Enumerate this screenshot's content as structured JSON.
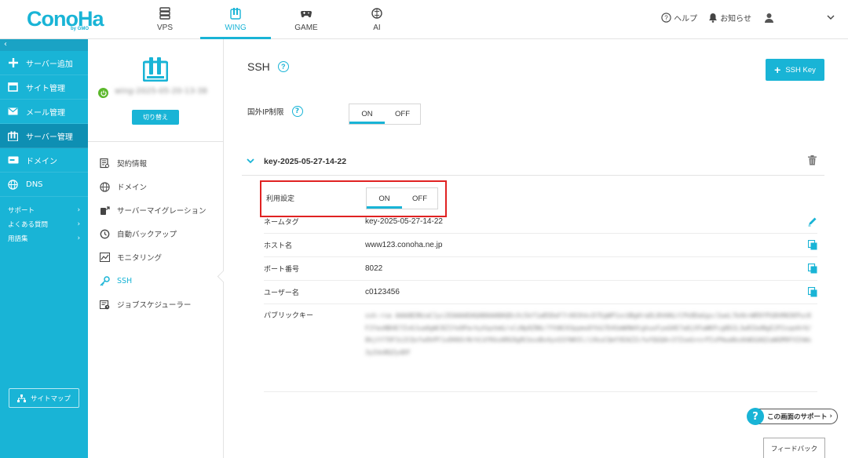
{
  "logo": {
    "text": "ConoHa",
    "sub": "by GMO"
  },
  "topnav": [
    {
      "label": "VPS",
      "icon": "server-icon",
      "active": false
    },
    {
      "label": "WING",
      "icon": "wing-icon",
      "active": true
    },
    {
      "label": "GAME",
      "icon": "gamepad-icon",
      "active": false
    },
    {
      "label": "AI",
      "icon": "ai-brain-icon",
      "active": false
    }
  ],
  "header_right": {
    "help": "ヘルプ",
    "notice": "お知らせ"
  },
  "sidebar": {
    "collapse": "‹",
    "items": [
      {
        "label": "サーバー追加",
        "icon": "plus-icon"
      },
      {
        "label": "サイト管理",
        "icon": "window-icon"
      },
      {
        "label": "メール管理",
        "icon": "mail-icon"
      },
      {
        "label": "サーバー管理",
        "icon": "server-manage-icon"
      },
      {
        "label": "ドメイン",
        "icon": "domain-icon"
      },
      {
        "label": "DNS",
        "icon": "globe-icon"
      }
    ],
    "sub": [
      {
        "label": "サポート"
      },
      {
        "label": "よくある質問"
      },
      {
        "label": "用語集"
      }
    ],
    "sitemap": "サイトマップ"
  },
  "server_panel": {
    "name": "wing-2025-05-20-13-38",
    "switch_label": "切り替え",
    "menu": [
      {
        "label": "契約情報",
        "icon": "contract-icon"
      },
      {
        "label": "ドメイン",
        "icon": "globe-icon"
      },
      {
        "label": "サーバーマイグレーション",
        "icon": "migration-icon"
      },
      {
        "label": "自動バックアップ",
        "icon": "backup-icon"
      },
      {
        "label": "モニタリング",
        "icon": "monitoring-icon"
      },
      {
        "label": "SSH",
        "icon": "key-icon"
      },
      {
        "label": "ジョブスケジューラー",
        "icon": "scheduler-icon"
      }
    ]
  },
  "main": {
    "title": "SSH",
    "add_key": "SSH Key",
    "ip_limit_label": "国外IP制限",
    "toggle_on": "ON",
    "toggle_off": "OFF",
    "key_name": "key-2025-05-27-14-22",
    "use_setting_label": "利用設定",
    "rows": [
      {
        "key": "ネームタグ",
        "value": "key-2025-05-27-14-22"
      },
      {
        "key": "ホスト名",
        "value": "www123.conoha.ne.jp"
      },
      {
        "key": "ポート番号",
        "value": "8022"
      },
      {
        "key": "ユーザー名",
        "value": "c0123456"
      }
    ],
    "public_key_label": "パブリックキー",
    "public_key": "ssh-rsa AAAAB3NzaC1yc2EAAAADAQABAAABAQDcXc5kf1aB5DeF7rA93hkcD7EgWP1ocUBgHraDL8hHAG/CPk8DaGgs/2weL7b4k+WR9fPG8hMA5KPucKF2YeoNB4E7Zv6Jua0gWC8Z1Ye9ParkyVqxhmG/vCzNp8ZN6/7YhNCH3ppmoDYkG7D4SmWHW4tghuoFyeGHE7a0jXFwWKPcg8D2L3wRIbdNgE2P2sqoHrH/8kjtY7OF3z2CQsfwOhPF1xDH6OrNrhCdfKko0RG9gRCbsoBo4yoSSYWH3l/iXkuCQmfXEAZZcfwYQGQA+37ZxeG+nrPIsPHwaNsdkWGGAQ1aWGM9FXIhWs3yZdoBQZydDF"
  },
  "support": "この画面のサポート",
  "feedback": "フィードバック",
  "colors": {
    "accent": "#19b4d6",
    "sidebar_active": "#0e8fb3",
    "highlight": "#e02222"
  }
}
